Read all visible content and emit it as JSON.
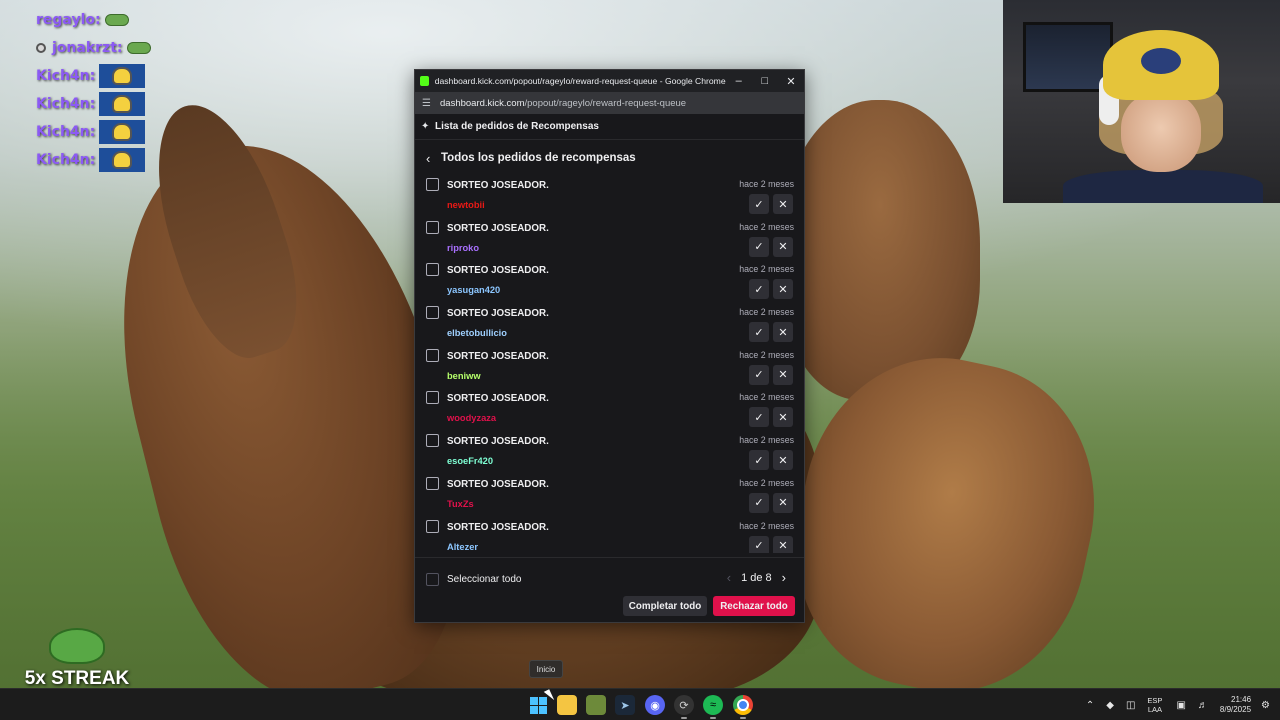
{
  "chat": {
    "lines": [
      {
        "user": "regaylo:",
        "color": "#8c5af5",
        "emote": "frog"
      },
      {
        "user": "jonakrzt:",
        "color": "#8c5af5",
        "emote": "frog",
        "badge": true
      },
      {
        "user": "Kich4n:",
        "color": "#8c5af5",
        "emote": "minion"
      },
      {
        "user": "Kich4n:",
        "color": "#8c5af5",
        "emote": "minion"
      },
      {
        "user": "Kich4n:",
        "color": "#8c5af5",
        "emote": "minion"
      },
      {
        "user": "Kich4n:",
        "color": "#8c5af5",
        "emote": "minion"
      }
    ]
  },
  "streak": {
    "text": "5x STREAK"
  },
  "chrome": {
    "window_title": "dashboard.kick.com/popout/rageylo/reward-request-queue - Google Chrome",
    "url_host": "dashboard.kick.com",
    "url_path": "/popout/rageylo/reward-request-queue"
  },
  "panel": {
    "header": "Lista de pedidos de Recompensas",
    "back_label": "Todos los pedidos de recompensas",
    "items": [
      {
        "reward": "SORTEO JOSEADOR.",
        "time": "hace 2 meses",
        "user": "newtobii",
        "user_color": "#e91916"
      },
      {
        "reward": "SORTEO JOSEADOR.",
        "time": "hace 2 meses",
        "user": "riproko",
        "user_color": "#a970ff"
      },
      {
        "reward": "SORTEO JOSEADOR.",
        "time": "hace 2 meses",
        "user": "yasugan420",
        "user_color": "#8cc6ff"
      },
      {
        "reward": "SORTEO JOSEADOR.",
        "time": "hace 2 meses",
        "user": "elbetobullicio",
        "user_color": "#9fd0ff"
      },
      {
        "reward": "SORTEO JOSEADOR.",
        "time": "hace 2 meses",
        "user": "beniww",
        "user_color": "#b6ff6b"
      },
      {
        "reward": "SORTEO JOSEADOR.",
        "time": "hace 2 meses",
        "user": "woodyzaza",
        "user_color": "#e0114b"
      },
      {
        "reward": "SORTEO JOSEADOR.",
        "time": "hace 2 meses",
        "user": "esoeFr420",
        "user_color": "#7fffd4"
      },
      {
        "reward": "SORTEO JOSEADOR.",
        "time": "hace 2 meses",
        "user": "TuxZs",
        "user_color": "#e0114b"
      },
      {
        "reward": "SORTEO JOSEADOR.",
        "time": "hace 2 meses",
        "user": "Altezer",
        "user_color": "#8cc6ff"
      }
    ],
    "select_all": "Seleccionar todo",
    "pagination": "1 de 8",
    "complete_all": "Completar todo",
    "reject_all": "Rechazar todo"
  },
  "taskbar": {
    "tooltip": "Inicio",
    "lang_top": "ESP",
    "lang_bottom": "LAA",
    "time": "21:46",
    "date": "8/9/2025"
  },
  "colors": {
    "accent_reject": "#e0114b",
    "kick_green": "#53fc18"
  }
}
